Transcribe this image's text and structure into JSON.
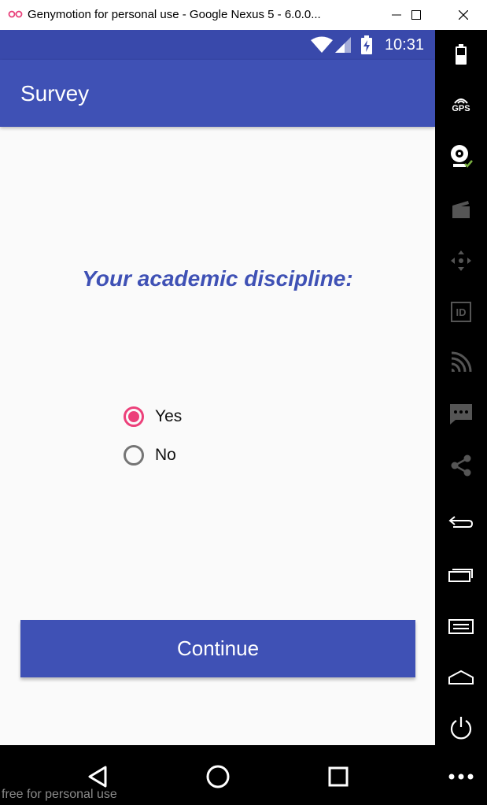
{
  "window": {
    "title": "Genymotion for personal use - Google Nexus 5 - 6.0.0..."
  },
  "status_bar": {
    "time": "10:31"
  },
  "app_bar": {
    "title": "Survey"
  },
  "question": {
    "text": "Your academic discipline:"
  },
  "options": [
    {
      "label": "Yes",
      "checked": true
    },
    {
      "label": "No",
      "checked": false
    }
  ],
  "continue_button": {
    "label": "Continue"
  },
  "sidebar": {
    "gps_label": "GPS",
    "id_label": "ID"
  },
  "watermark": "free for personal use",
  "colors": {
    "primary": "#3f51b5",
    "primary_dark": "#3949ab",
    "accent": "#ec407a"
  }
}
